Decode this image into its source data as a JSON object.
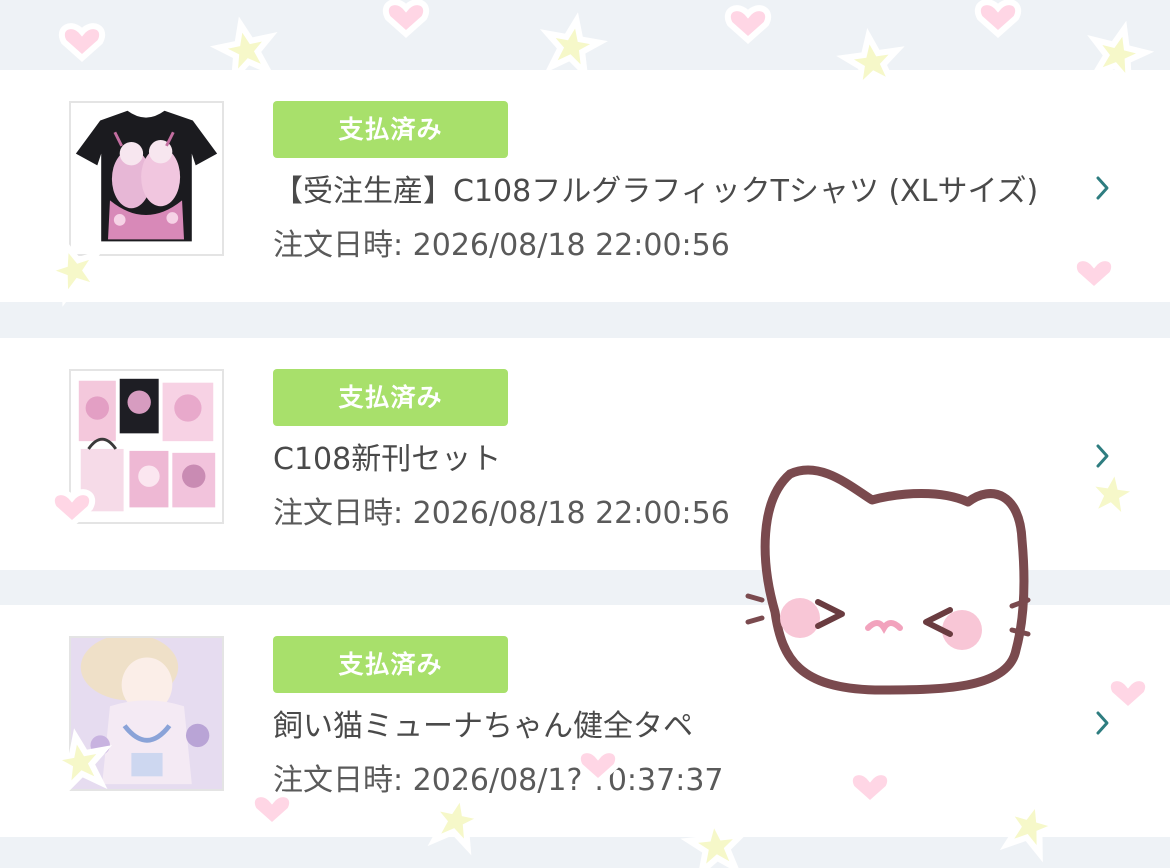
{
  "orders": [
    {
      "status": "支払済み",
      "title": "【受注生産】C108フルグラフィックTシャツ (XLサイズ)",
      "date": "注文日時: 2026/08/18 22:00:56",
      "thumbnail_icon": "tshirt-thumbnail"
    },
    {
      "status": "支払済み",
      "title": "C108新刊セット",
      "date": "注文日時: 2026/08/18 22:00:56",
      "thumbnail_icon": "book-set-thumbnail"
    },
    {
      "status": "支払済み",
      "title": "飼い猫ミューナちゃん健全タペ",
      "date": "注文日時: 2026/08/1? ?0:37:37",
      "thumbnail_icon": "tapestry-thumbnail"
    }
  ],
  "colors": {
    "page_background": "#eef2f6",
    "card_background": "#ffffff",
    "status_badge": "#a8e06b",
    "chevron": "#2e7d80",
    "text": "#4a4a4a"
  },
  "icons": {
    "chevron": "chevron-right-icon",
    "sticker": "cat-face-sticker",
    "decorations": [
      "heart-icon",
      "star-icon"
    ]
  }
}
